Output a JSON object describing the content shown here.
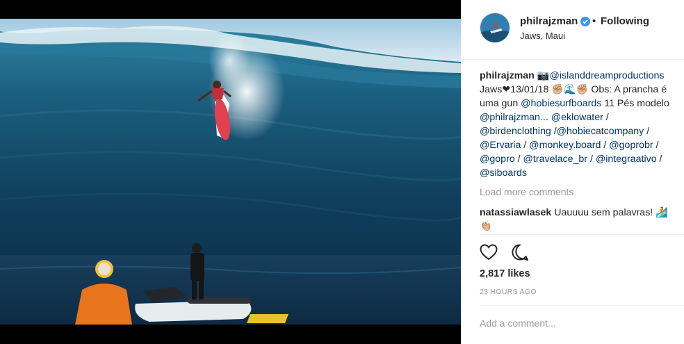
{
  "header": {
    "username": "philrajzman",
    "separator": "•",
    "follow_state": "Following",
    "location": "Jaws, Maui"
  },
  "caption": {
    "username": "philrajzman",
    "lines": [
      [
        {
          "t": "📷",
          "m": false
        },
        {
          "t": "@islanddreamproductions",
          "m": true
        }
      ],
      [
        {
          "t": "Jaws❤13/01/18 ✊🏼🌊✊🏼 Obs: A prancha é",
          "m": false
        }
      ],
      [
        {
          "t": "uma gun ",
          "m": false
        },
        {
          "t": "@hobiesurfboards",
          "m": true
        },
        {
          "t": " 11 Pés modelo",
          "m": false
        }
      ],
      [
        {
          "t": "@philrajzman",
          "m": true
        },
        {
          "t": "... ",
          "m": false
        },
        {
          "t": "@eklowater",
          "m": true
        },
        {
          "t": " /",
          "m": false
        }
      ],
      [
        {
          "t": "@birdenclothing",
          "m": true
        },
        {
          "t": " /",
          "m": false
        },
        {
          "t": "@hobiecatcompany",
          "m": true
        },
        {
          "t": " /",
          "m": false
        }
      ],
      [
        {
          "t": "@Ervaria",
          "m": true
        },
        {
          "t": " / ",
          "m": false
        },
        {
          "t": "@monkey.board",
          "m": true
        },
        {
          "t": " / ",
          "m": false
        },
        {
          "t": "@goprobr",
          "m": true
        },
        {
          "t": " /",
          "m": false
        }
      ],
      [
        {
          "t": "@gopro",
          "m": true
        },
        {
          "t": " / ",
          "m": false
        },
        {
          "t": "@travelace_br",
          "m": true
        },
        {
          "t": " / ",
          "m": false
        },
        {
          "t": "@integraativo",
          "m": true
        },
        {
          "t": " /",
          "m": false
        }
      ],
      [
        {
          "t": "@siboards",
          "m": true
        }
      ]
    ]
  },
  "load_more": "Load more comments",
  "comment": {
    "username": "natassiawlasek",
    "line1": "Uauuuu sem palavras! 🏄",
    "line2": "👏🏼"
  },
  "actions": {
    "like_icon": "heart-icon",
    "comment_icon": "comment-bubble-icon"
  },
  "likes": "2,817 likes",
  "timestamp": "23 HOURS AGO",
  "add_comment_placeholder": "Add a comment..."
}
